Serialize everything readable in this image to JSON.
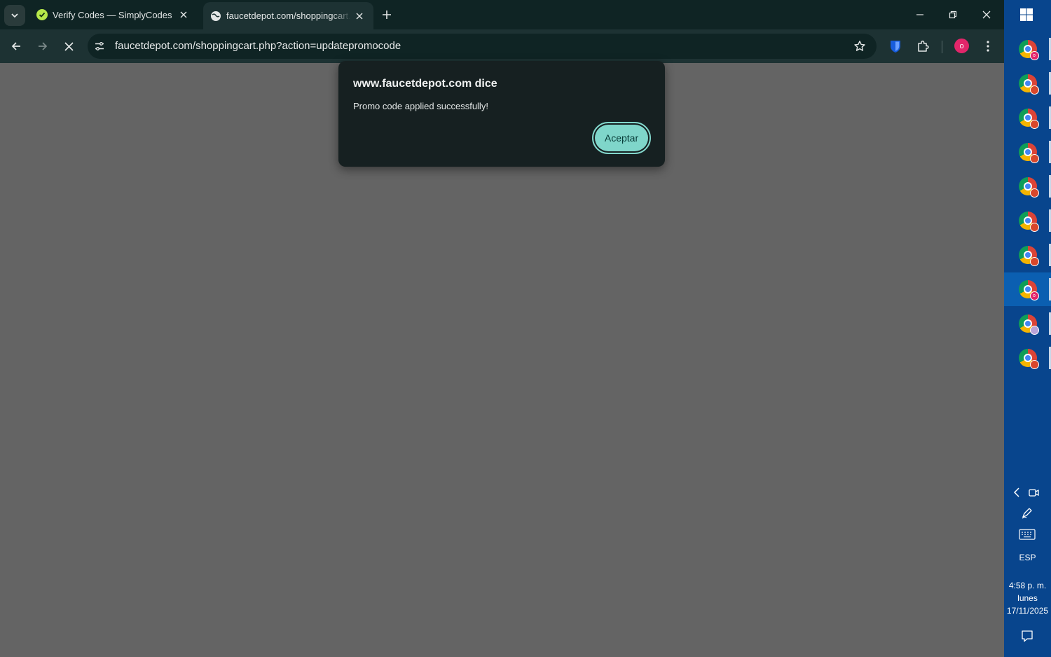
{
  "browser": {
    "tabs": [
      {
        "title": "Verify Codes — SimplyCodes",
        "active": false,
        "favicon": "simplycodes-check-icon"
      },
      {
        "title": "faucetdepot.com/shoppingcart.php?action=updatepromocode",
        "active": true,
        "favicon": "globe-icon"
      }
    ],
    "url": "faucetdepot.com/shoppingcart.php?action=updatepromocode",
    "profile_initial": "o"
  },
  "dialog": {
    "title": "www.faucetdepot.com dice",
    "message": "Promo code applied successfully!",
    "ok_label": "Aceptar"
  },
  "taskbar": {
    "apps": [
      {
        "name": "chrome",
        "badge_color": "#e2266a",
        "badge_text": "o"
      },
      {
        "name": "chrome",
        "badge_color": "#d8472b",
        "badge_text": ""
      },
      {
        "name": "chrome",
        "badge_color": "#d8472b",
        "badge_text": ""
      },
      {
        "name": "chrome",
        "badge_color": "#d8472b",
        "badge_text": ""
      },
      {
        "name": "chrome",
        "badge_color": "#d8472b",
        "badge_text": ""
      },
      {
        "name": "chrome",
        "badge_color": "#d8472b",
        "badge_text": ""
      },
      {
        "name": "chrome",
        "badge_color": "#d8472b",
        "badge_text": ""
      },
      {
        "name": "chrome",
        "badge_color": "#e2266a",
        "badge_text": "o",
        "selected": true
      },
      {
        "name": "chrome",
        "badge_color": "#b9a3d8",
        "badge_text": ""
      },
      {
        "name": "chrome",
        "badge_color": "#d8472b",
        "badge_text": ""
      }
    ],
    "language": "ESP",
    "time": "4:58 p. m.",
    "weekday": "lunes",
    "date": "17/11/2025"
  },
  "colors": {
    "titlebar": "#0f2424",
    "toolbar": "#1d3233",
    "dialog_bg": "#162021",
    "accent": "#7fd6ca",
    "taskbar": "#08458d"
  }
}
